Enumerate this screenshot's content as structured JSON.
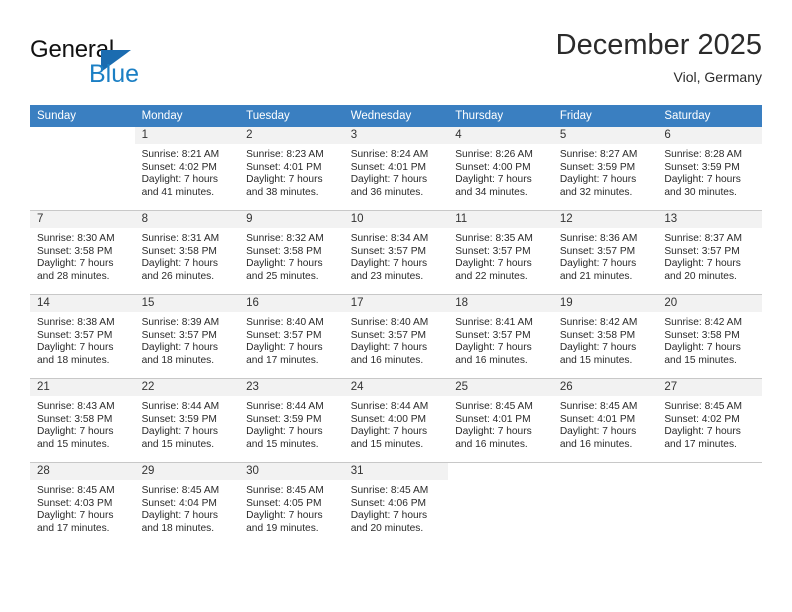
{
  "brand": {
    "name_part1": "General",
    "name_part2": "Blue",
    "triangle_color": "#1b6cb0",
    "blue_text_color": "#1b7fc4"
  },
  "header": {
    "title": "December 2025",
    "subtitle": "Viol, Germany"
  },
  "theme": {
    "header_row_bg": "#3a7fc1",
    "day_band_bg": "#f2f2f2",
    "grid_line": "#c8c8c8",
    "text": "#2a2a2a"
  },
  "weekday_headers": [
    "Sunday",
    "Monday",
    "Tuesday",
    "Wednesday",
    "Thursday",
    "Friday",
    "Saturday"
  ],
  "weeks": [
    [
      {
        "day": "",
        "sunrise": "",
        "sunset": "",
        "daylight": "",
        "empty": true
      },
      {
        "day": "1",
        "sunrise": "Sunrise: 8:21 AM",
        "sunset": "Sunset: 4:02 PM",
        "daylight": "Daylight: 7 hours and 41 minutes."
      },
      {
        "day": "2",
        "sunrise": "Sunrise: 8:23 AM",
        "sunset": "Sunset: 4:01 PM",
        "daylight": "Daylight: 7 hours and 38 minutes."
      },
      {
        "day": "3",
        "sunrise": "Sunrise: 8:24 AM",
        "sunset": "Sunset: 4:01 PM",
        "daylight": "Daylight: 7 hours and 36 minutes."
      },
      {
        "day": "4",
        "sunrise": "Sunrise: 8:26 AM",
        "sunset": "Sunset: 4:00 PM",
        "daylight": "Daylight: 7 hours and 34 minutes."
      },
      {
        "day": "5",
        "sunrise": "Sunrise: 8:27 AM",
        "sunset": "Sunset: 3:59 PM",
        "daylight": "Daylight: 7 hours and 32 minutes."
      },
      {
        "day": "6",
        "sunrise": "Sunrise: 8:28 AM",
        "sunset": "Sunset: 3:59 PM",
        "daylight": "Daylight: 7 hours and 30 minutes."
      }
    ],
    [
      {
        "day": "7",
        "sunrise": "Sunrise: 8:30 AM",
        "sunset": "Sunset: 3:58 PM",
        "daylight": "Daylight: 7 hours and 28 minutes."
      },
      {
        "day": "8",
        "sunrise": "Sunrise: 8:31 AM",
        "sunset": "Sunset: 3:58 PM",
        "daylight": "Daylight: 7 hours and 26 minutes."
      },
      {
        "day": "9",
        "sunrise": "Sunrise: 8:32 AM",
        "sunset": "Sunset: 3:58 PM",
        "daylight": "Daylight: 7 hours and 25 minutes."
      },
      {
        "day": "10",
        "sunrise": "Sunrise: 8:34 AM",
        "sunset": "Sunset: 3:57 PM",
        "daylight": "Daylight: 7 hours and 23 minutes."
      },
      {
        "day": "11",
        "sunrise": "Sunrise: 8:35 AM",
        "sunset": "Sunset: 3:57 PM",
        "daylight": "Daylight: 7 hours and 22 minutes."
      },
      {
        "day": "12",
        "sunrise": "Sunrise: 8:36 AM",
        "sunset": "Sunset: 3:57 PM",
        "daylight": "Daylight: 7 hours and 21 minutes."
      },
      {
        "day": "13",
        "sunrise": "Sunrise: 8:37 AM",
        "sunset": "Sunset: 3:57 PM",
        "daylight": "Daylight: 7 hours and 20 minutes."
      }
    ],
    [
      {
        "day": "14",
        "sunrise": "Sunrise: 8:38 AM",
        "sunset": "Sunset: 3:57 PM",
        "daylight": "Daylight: 7 hours and 18 minutes."
      },
      {
        "day": "15",
        "sunrise": "Sunrise: 8:39 AM",
        "sunset": "Sunset: 3:57 PM",
        "daylight": "Daylight: 7 hours and 18 minutes."
      },
      {
        "day": "16",
        "sunrise": "Sunrise: 8:40 AM",
        "sunset": "Sunset: 3:57 PM",
        "daylight": "Daylight: 7 hours and 17 minutes."
      },
      {
        "day": "17",
        "sunrise": "Sunrise: 8:40 AM",
        "sunset": "Sunset: 3:57 PM",
        "daylight": "Daylight: 7 hours and 16 minutes."
      },
      {
        "day": "18",
        "sunrise": "Sunrise: 8:41 AM",
        "sunset": "Sunset: 3:57 PM",
        "daylight": "Daylight: 7 hours and 16 minutes."
      },
      {
        "day": "19",
        "sunrise": "Sunrise: 8:42 AM",
        "sunset": "Sunset: 3:58 PM",
        "daylight": "Daylight: 7 hours and 15 minutes."
      },
      {
        "day": "20",
        "sunrise": "Sunrise: 8:42 AM",
        "sunset": "Sunset: 3:58 PM",
        "daylight": "Daylight: 7 hours and 15 minutes."
      }
    ],
    [
      {
        "day": "21",
        "sunrise": "Sunrise: 8:43 AM",
        "sunset": "Sunset: 3:58 PM",
        "daylight": "Daylight: 7 hours and 15 minutes."
      },
      {
        "day": "22",
        "sunrise": "Sunrise: 8:44 AM",
        "sunset": "Sunset: 3:59 PM",
        "daylight": "Daylight: 7 hours and 15 minutes."
      },
      {
        "day": "23",
        "sunrise": "Sunrise: 8:44 AM",
        "sunset": "Sunset: 3:59 PM",
        "daylight": "Daylight: 7 hours and 15 minutes."
      },
      {
        "day": "24",
        "sunrise": "Sunrise: 8:44 AM",
        "sunset": "Sunset: 4:00 PM",
        "daylight": "Daylight: 7 hours and 15 minutes."
      },
      {
        "day": "25",
        "sunrise": "Sunrise: 8:45 AM",
        "sunset": "Sunset: 4:01 PM",
        "daylight": "Daylight: 7 hours and 16 minutes."
      },
      {
        "day": "26",
        "sunrise": "Sunrise: 8:45 AM",
        "sunset": "Sunset: 4:01 PM",
        "daylight": "Daylight: 7 hours and 16 minutes."
      },
      {
        "day": "27",
        "sunrise": "Sunrise: 8:45 AM",
        "sunset": "Sunset: 4:02 PM",
        "daylight": "Daylight: 7 hours and 17 minutes."
      }
    ],
    [
      {
        "day": "28",
        "sunrise": "Sunrise: 8:45 AM",
        "sunset": "Sunset: 4:03 PM",
        "daylight": "Daylight: 7 hours and 17 minutes."
      },
      {
        "day": "29",
        "sunrise": "Sunrise: 8:45 AM",
        "sunset": "Sunset: 4:04 PM",
        "daylight": "Daylight: 7 hours and 18 minutes."
      },
      {
        "day": "30",
        "sunrise": "Sunrise: 8:45 AM",
        "sunset": "Sunset: 4:05 PM",
        "daylight": "Daylight: 7 hours and 19 minutes."
      },
      {
        "day": "31",
        "sunrise": "Sunrise: 8:45 AM",
        "sunset": "Sunset: 4:06 PM",
        "daylight": "Daylight: 7 hours and 20 minutes."
      },
      {
        "day": "",
        "sunrise": "",
        "sunset": "",
        "daylight": "",
        "empty": true
      },
      {
        "day": "",
        "sunrise": "",
        "sunset": "",
        "daylight": "",
        "empty": true
      },
      {
        "day": "",
        "sunrise": "",
        "sunset": "",
        "daylight": "",
        "empty": true
      }
    ]
  ]
}
